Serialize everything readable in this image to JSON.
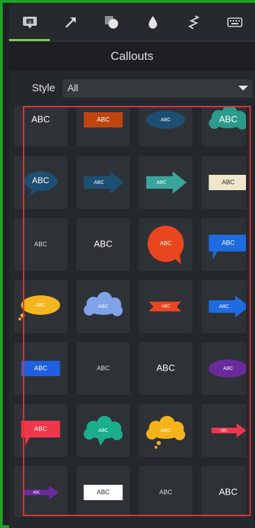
{
  "toolbar": {
    "tools": [
      {
        "name": "callouts-tab",
        "icon": "annotation-icon",
        "active": true
      },
      {
        "name": "arrows-lines-tab",
        "icon": "arrow-icon",
        "active": false
      },
      {
        "name": "shapes-tab",
        "icon": "shape-icon",
        "active": false
      },
      {
        "name": "blur-highlight-tab",
        "icon": "drop-icon",
        "active": false
      },
      {
        "name": "sketch-motion-tab",
        "icon": "squiggle-icon",
        "active": false
      },
      {
        "name": "keystroke-tab",
        "icon": "keyboard-icon",
        "active": false
      }
    ]
  },
  "panel": {
    "title": "Callouts"
  },
  "style_filter": {
    "label": "Style",
    "selected": "All"
  },
  "callouts": [
    {
      "kind": "text",
      "text": "ABC"
    },
    {
      "kind": "rect",
      "color": "#c0440f",
      "text": "ABC"
    },
    {
      "kind": "oval",
      "color": "#1d4f73",
      "text": "ABC"
    },
    {
      "kind": "cloud",
      "color": "#2c9b8b",
      "text": "ABC"
    },
    {
      "kind": "oval-bubble",
      "color": "#1d4f73",
      "text": "ABC"
    },
    {
      "kind": "arrow",
      "color": "#1d4f73",
      "text": "ABC"
    },
    {
      "kind": "arrow",
      "color": "#3aa59a",
      "text": "ABC"
    },
    {
      "kind": "rect",
      "color": "#efe6cc",
      "text": "ABC",
      "dark": true
    },
    {
      "kind": "text-small",
      "text": "ABC"
    },
    {
      "kind": "text",
      "text": "ABC"
    },
    {
      "kind": "circle-bubble",
      "color": "#e9461f",
      "text": "ABC"
    },
    {
      "kind": "rect-bubble",
      "color": "#1f6be0",
      "text": "ABC"
    },
    {
      "kind": "oval-thought",
      "color": "#f3b61f",
      "text": "ABC"
    },
    {
      "kind": "cloud",
      "color": "#7fa2e8",
      "text": "ABC"
    },
    {
      "kind": "banner",
      "color": "#e9461f",
      "text": "ABC"
    },
    {
      "kind": "arrow",
      "color": "#1f6be0",
      "text": "ABC"
    },
    {
      "kind": "rect",
      "color": "#1f5fe0",
      "text": "ABC"
    },
    {
      "kind": "text-small",
      "text": "ABC"
    },
    {
      "kind": "text",
      "text": "ABC"
    },
    {
      "kind": "oval",
      "color": "#6a2a9c",
      "text": "ABC"
    },
    {
      "kind": "rect-bubble",
      "color": "#f0364a",
      "text": "ABC"
    },
    {
      "kind": "cloud-bubble",
      "color": "#1aae8d",
      "text": "ABC"
    },
    {
      "kind": "cloud-thought",
      "color": "#f5b31a",
      "text": "ABC"
    },
    {
      "kind": "arrow-thin",
      "color": "#f0364a",
      "text": "ABC"
    },
    {
      "kind": "arrow-thin",
      "color": "#6a2a9c",
      "text": "ABC"
    },
    {
      "kind": "rect",
      "color": "#ffffff",
      "text": "ABC",
      "dark": true
    },
    {
      "kind": "text-small",
      "text": "ABC"
    },
    {
      "kind": "text",
      "text": "ABC"
    }
  ]
}
